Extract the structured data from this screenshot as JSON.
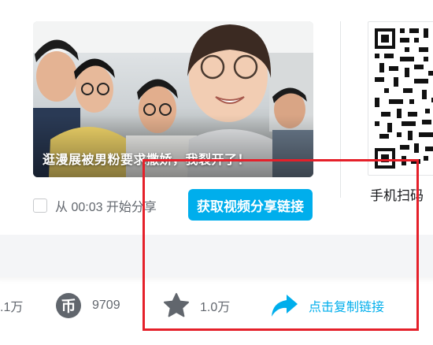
{
  "share_panel": {
    "video_title": "逛漫展被男粉要求撒娇，我裂开了！",
    "start_share_label": "从 00:03 开始分享",
    "get_link_button": "获取视频分享链接",
    "qr_label": "手机扫码"
  },
  "actions": {
    "like_count": ".1万",
    "coin_count": "9709",
    "favorite_count": "1.0万",
    "copy_link_label": "点击复制链接"
  },
  "colors": {
    "accent": "#00aeec",
    "highlight": "#e5202a",
    "icon_gray": "#61666d"
  },
  "icons": {
    "coin": "coin-icon",
    "favorite": "star-icon",
    "share": "share-arrow-icon"
  }
}
